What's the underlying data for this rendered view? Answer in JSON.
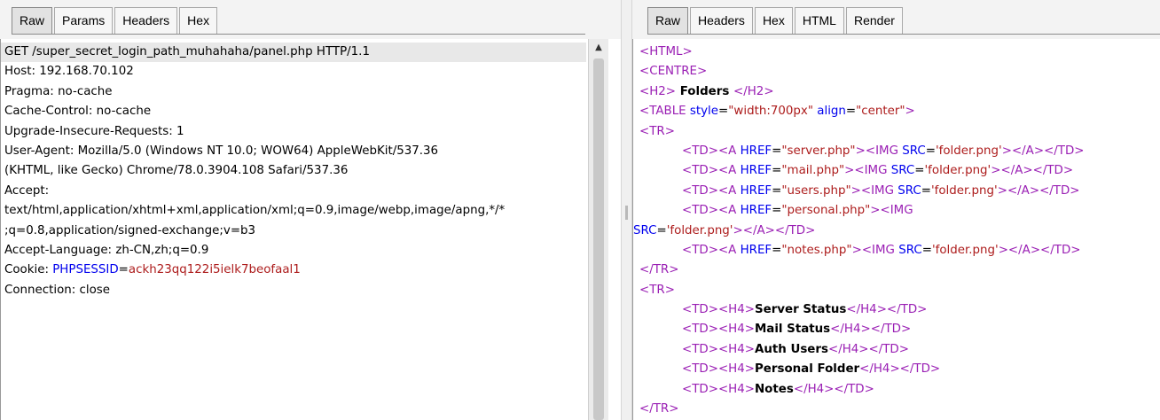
{
  "request": {
    "tabs": [
      {
        "label": "Raw",
        "active": true
      },
      {
        "label": "Params",
        "active": false
      },
      {
        "label": "Headers",
        "active": false
      },
      {
        "label": "Hex",
        "active": false
      }
    ],
    "lines": [
      "GET /super_secret_login_path_muhahaha/panel.php HTTP/1.1",
      "Host: 192.168.70.102",
      "Pragma: no-cache",
      "Cache-Control: no-cache",
      "Upgrade-Insecure-Requests: 1",
      "User-Agent: Mozilla/5.0 (Windows NT 10.0; WOW64) AppleWebKit/537.36",
      "(KHTML, like Gecko) Chrome/78.0.3904.108 Safari/537.36",
      "Accept:",
      "text/html,application/xhtml+xml,application/xml;q=0.9,image/webp,image/apng,*/*",
      ";q=0.8,application/signed-exchange;v=b3",
      "Accept-Language: zh-CN,zh;q=0.9"
    ],
    "cookie": {
      "prefix": "Cookie: ",
      "name": "PHPSESSID",
      "eq": "=",
      "value": "ackh23qq122i5ielk7beofaal1"
    },
    "last_line": "Connection: close",
    "scroll_up_icon": "▲"
  },
  "response": {
    "tabs": [
      {
        "label": "Raw",
        "active": true
      },
      {
        "label": "Headers",
        "active": false
      },
      {
        "label": "Hex",
        "active": false
      },
      {
        "label": "HTML",
        "active": false
      },
      {
        "label": "Render",
        "active": false
      }
    ],
    "code": {
      "html_open": "<HTML>",
      "centre_open": "<CENTRE>",
      "h2_open": "<H2>",
      "h2_text": " Folders ",
      "h2_close": "</H2>",
      "table_open": "<TABLE",
      "style_attr": "style",
      "style_val": "\"width:700px\"",
      "align_attr": "align",
      "align_val": "\"center\"",
      "gt": ">",
      "tr_open": "<TR>",
      "tr_close": "</TR>",
      "td_open": "<TD>",
      "td_close": "</TD>",
      "a_open": "<A",
      "a_close": "</A>",
      "href_attr": "HREF",
      "img_open": "<IMG",
      "src_attr": "SRC",
      "img_val": "'folder.png'",
      "h4_open": "<H4>",
      "h4_close": "</H4>",
      "links": [
        "\"server.php\"",
        "\"mail.php\"",
        "\"users.php\"",
        "\"personal.php\"",
        "\"notes.php\""
      ],
      "headings": [
        "Server Status",
        "Mail Status",
        "Auth Users",
        "Personal Folder",
        "Notes"
      ]
    }
  }
}
